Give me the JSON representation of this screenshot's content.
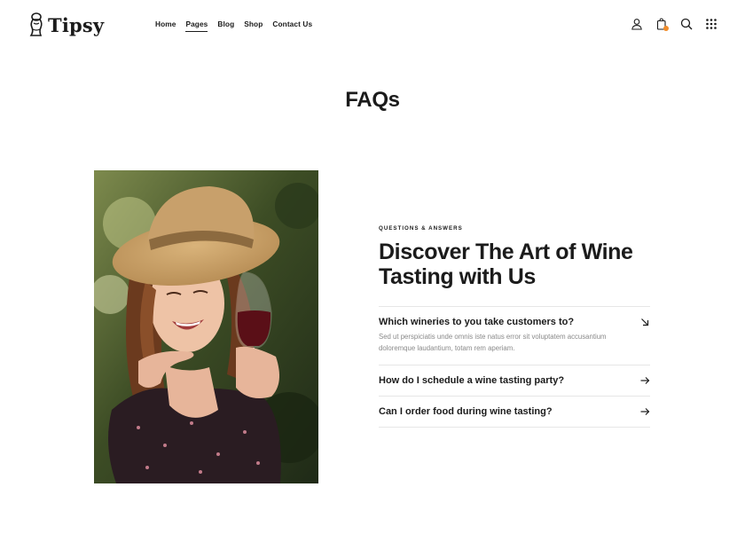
{
  "brand": {
    "name": "Tipsy"
  },
  "nav": {
    "items": [
      {
        "label": "Home"
      },
      {
        "label": "Pages"
      },
      {
        "label": "Blog"
      },
      {
        "label": "Shop"
      },
      {
        "label": "Contact Us"
      }
    ],
    "active": "Pages"
  },
  "header_icons": [
    "user-icon",
    "cart-icon",
    "search-icon",
    "grid-menu-icon"
  ],
  "page": {
    "title": "FAQs"
  },
  "faq": {
    "eyebrow": "QUESTIONS & ANSWERS",
    "headline": "Discover The Art of Wine Tasting with Us",
    "items": [
      {
        "question": "Which wineries to you take customers to?",
        "answer": "Sed ut perspiciatis unde omnis iste natus error sit voluptatem accusantium doloremque laudantium, totam rem aperiam.",
        "expanded": true
      },
      {
        "question": "How do I schedule a wine tasting party?",
        "expanded": false
      },
      {
        "question": "Can I order food during wine tasting?",
        "expanded": false
      }
    ]
  },
  "colors": {
    "text": "#1b1b1b",
    "muted": "#8a8a8a",
    "accent_dot": "#f08c2a",
    "divider": "#e6e6e6"
  }
}
